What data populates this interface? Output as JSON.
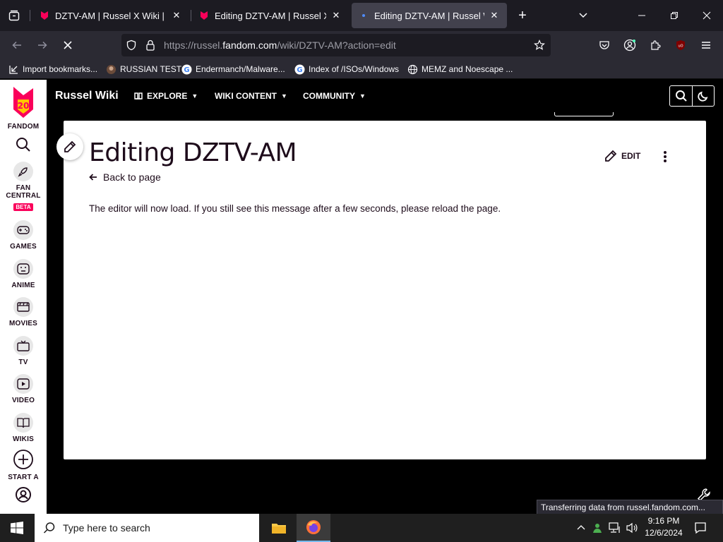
{
  "browser": {
    "tabs": [
      {
        "title": "DZTV-AM | Russel X Wiki | Fandom",
        "active": false
      },
      {
        "title": "Editing DZTV-AM | Russel X Wiki | Fandom",
        "active": false
      },
      {
        "title": "Editing DZTV-AM | Russel Wiki | Fandom",
        "active": true
      }
    ],
    "url_prefix": "https://russel.",
    "url_domain": "fandom.com",
    "url_suffix": "/wiki/DZTV-AM?action=edit",
    "bookmarks": [
      {
        "label": "Import bookmarks...",
        "icon": "import-icon"
      },
      {
        "label": "RUSSIAN TEST",
        "icon": "site-favicon"
      },
      {
        "label": "Endermanch/Malware...",
        "icon": "google-favicon"
      },
      {
        "label": "Index of /ISOs/Windows",
        "icon": "google-favicon"
      },
      {
        "label": "MEMZ and Noescape ...",
        "icon": "globe-icon"
      }
    ],
    "status_text": "Transferring data from russel.fandom.com..."
  },
  "fandom_sidebar": {
    "logo_label": "FANDOM",
    "logo_badge": "20",
    "items": [
      {
        "label": "FAN",
        "label2": "CENTRAL",
        "badge": "BETA",
        "icon": "rocket-icon"
      },
      {
        "label": "GAMES",
        "icon": "gamepad-icon"
      },
      {
        "label": "ANIME",
        "icon": "anime-face-icon"
      },
      {
        "label": "MOVIES",
        "icon": "clapperboard-icon"
      },
      {
        "label": "TV",
        "icon": "tv-icon"
      },
      {
        "label": "VIDEO",
        "icon": "play-icon"
      },
      {
        "label": "WIKIS",
        "icon": "book-icon"
      },
      {
        "label": "START A",
        "icon": "plus-circle-icon"
      }
    ]
  },
  "wiki_header": {
    "name": "Russel Wiki",
    "nav": [
      {
        "label": "EXPLORE",
        "icon": "explore-icon"
      },
      {
        "label": "WIKI CONTENT"
      },
      {
        "label": "COMMUNITY"
      }
    ]
  },
  "page": {
    "title": "Editing DZTV-AM",
    "back_link": "Back to page",
    "edit_label": "EDIT",
    "notice_before": "The editor will now load. If you still see this message after a few seconds, please ",
    "notice_link": "reload the page",
    "notice_after": "."
  },
  "taskbar": {
    "search_placeholder": "Type here to search",
    "time": "9:16 PM",
    "date": "12/6/2024"
  },
  "colors": {
    "fandom_pink": "#fa005a",
    "fandom_yellow": "#ffc500",
    "browser_dark": "#1c1b22",
    "browser_toolbar": "#2b2a33"
  }
}
